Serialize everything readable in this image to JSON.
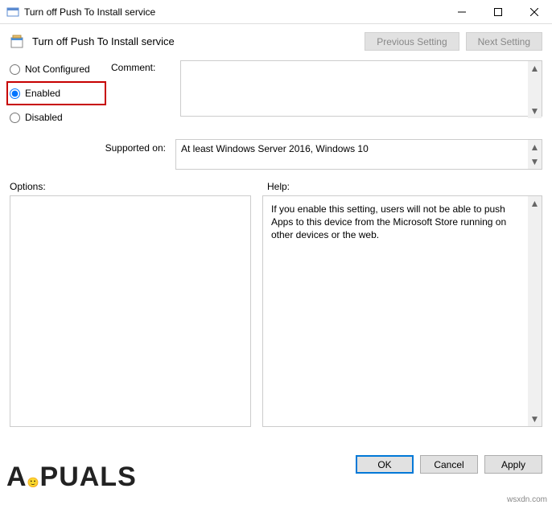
{
  "window": {
    "title": "Turn off Push To Install service",
    "minimize_name": "minimize",
    "maximize_name": "maximize",
    "close_name": "close"
  },
  "header": {
    "title": "Turn off Push To Install service",
    "prev_label": "Previous Setting",
    "next_label": "Next Setting"
  },
  "state": {
    "not_configured": "Not Configured",
    "enabled": "Enabled",
    "disabled": "Disabled",
    "selected": "enabled"
  },
  "labels": {
    "comment": "Comment:",
    "supported_on": "Supported on:",
    "options": "Options:",
    "help": "Help:"
  },
  "fields": {
    "comment_value": "",
    "supported_value": "At least Windows Server 2016, Windows 10",
    "options_value": "",
    "help_value": "If you enable this setting, users will not be able to push Apps to this device from the Microsoft Store running on other devices or the web."
  },
  "buttons": {
    "ok": "OK",
    "cancel": "Cancel",
    "apply": "Apply"
  },
  "branding": {
    "site": "wsxdn.com"
  }
}
